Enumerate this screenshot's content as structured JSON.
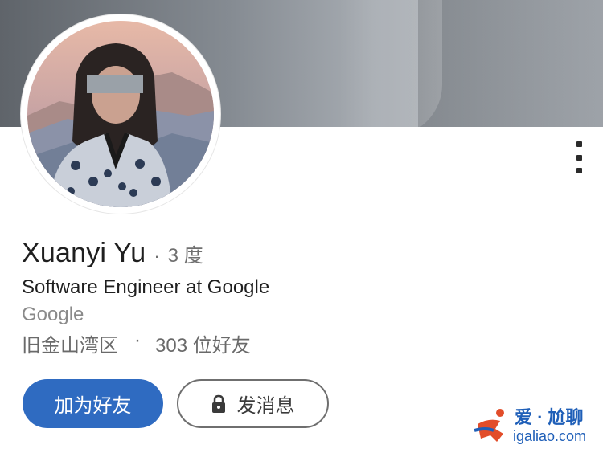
{
  "profile": {
    "name": "Xuanyi Yu",
    "separator": "·",
    "degree": "3 度",
    "headline": "Software Engineer at Google",
    "company": "Google",
    "location": "旧金山湾区",
    "meta_separator": "·",
    "connections": "303 位好友"
  },
  "actions": {
    "add_friend_label": "加为好友",
    "message_label": "发消息"
  },
  "icons": {
    "more": "more-vertical-icon",
    "lock": "lock-icon"
  },
  "watermark": {
    "line1": "爱 · 尬聊",
    "line2": "igaliao.com"
  },
  "colors": {
    "primary": "#2f6bc1",
    "text": "#1f1f1f",
    "muted": "#8a8a8a"
  }
}
